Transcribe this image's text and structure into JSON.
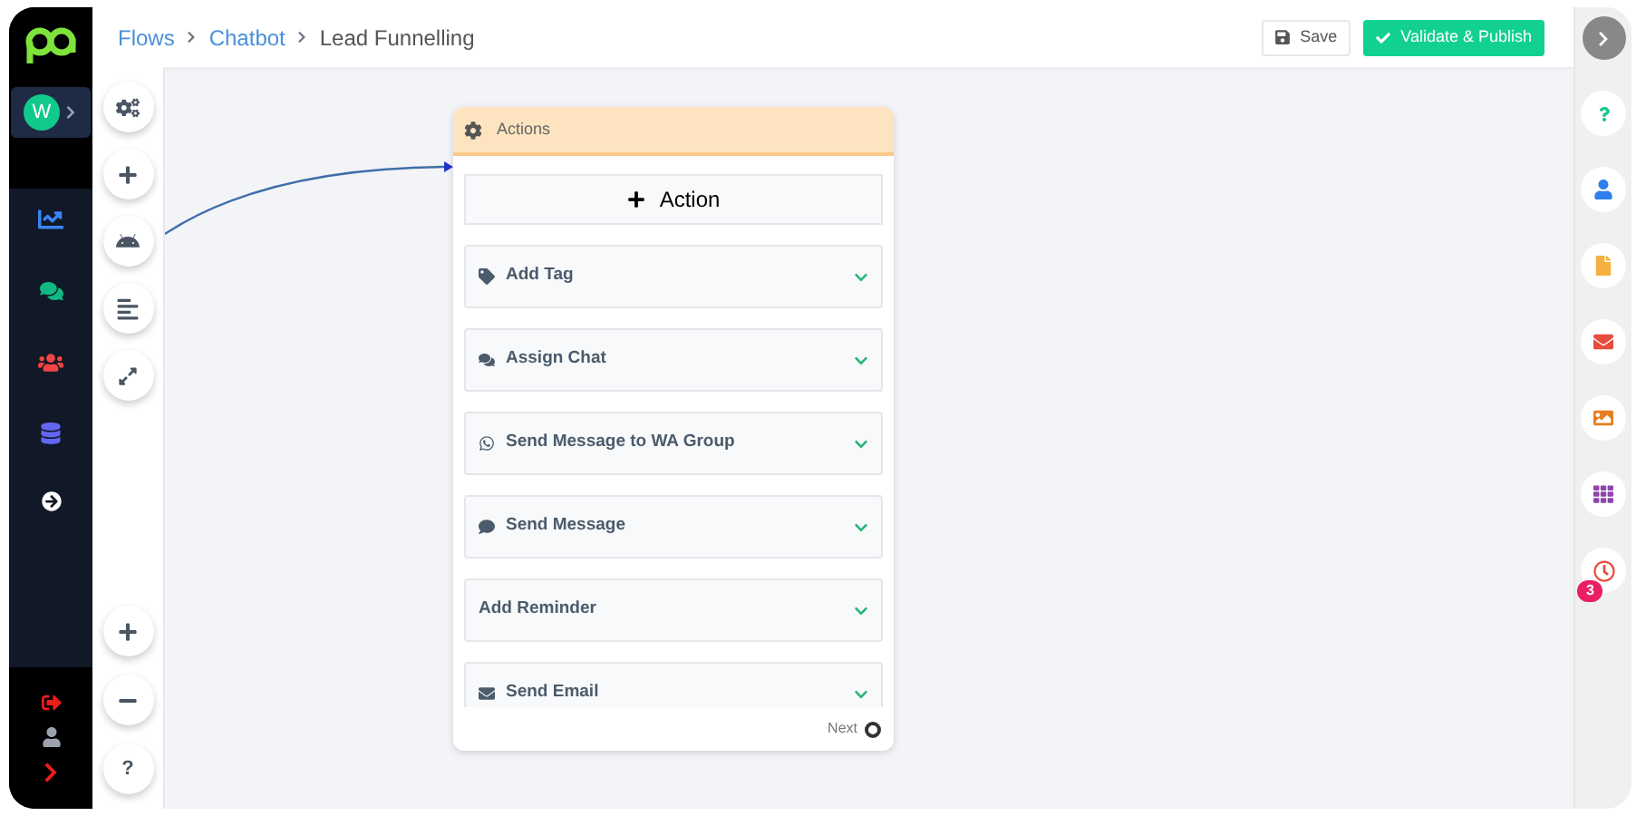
{
  "breadcrumbs": [
    {
      "label": "Flows",
      "link": true
    },
    {
      "label": "Chatbot",
      "link": true
    },
    {
      "label": "Lead Funnelling",
      "link": false
    }
  ],
  "toolbar": {
    "save": "Save",
    "publish": "Validate & Publish"
  },
  "account": {
    "initial": "W"
  },
  "node": {
    "title": "Actions",
    "add_button": "Action",
    "next": "Next",
    "items": [
      {
        "label": "Add Tag"
      },
      {
        "label": "Assign Chat"
      },
      {
        "label": "Send Message to WA Group"
      },
      {
        "label": "Send Message"
      },
      {
        "label": "Add Reminder"
      },
      {
        "label": "Send Email"
      }
    ]
  },
  "right_rail": {
    "reminder_badge": "3"
  },
  "zoom_help": "?"
}
